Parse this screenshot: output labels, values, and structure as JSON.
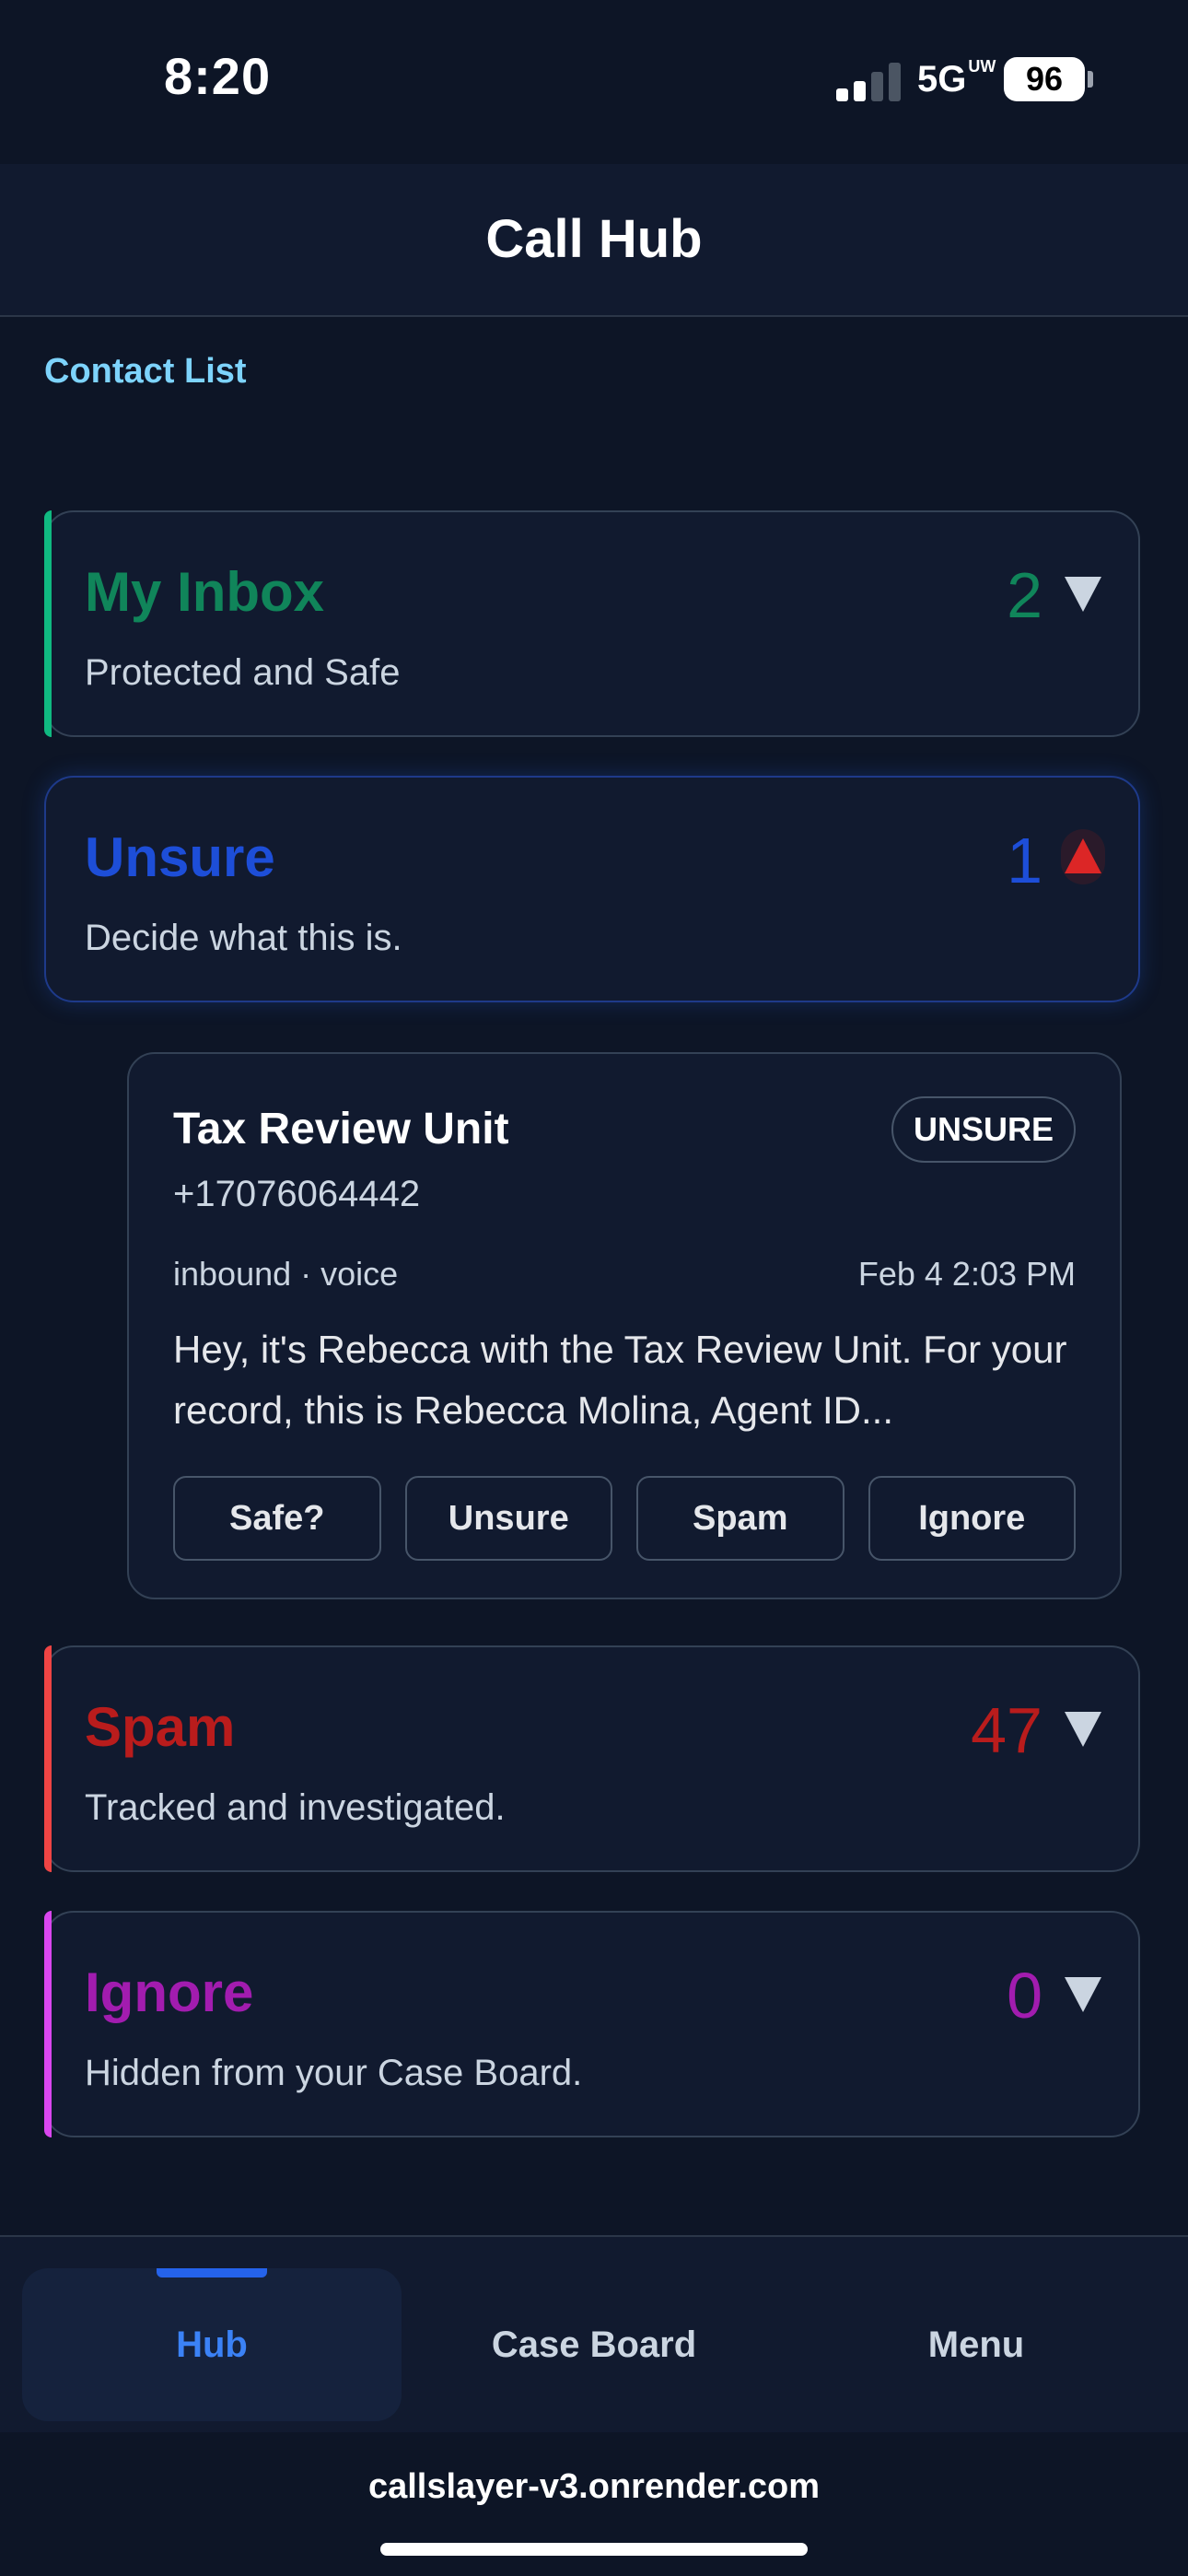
{
  "status_bar": {
    "time": "8:20",
    "network": "5G",
    "network_suffix": "UW",
    "battery": "96"
  },
  "header": {
    "title": "Call Hub"
  },
  "contact_list_label": "Contact List",
  "folders": [
    {
      "title": "My Inbox",
      "subtitle": "Protected and Safe",
      "count": "2",
      "color": "#10855a"
    },
    {
      "title": "Unsure",
      "subtitle": "Decide what this is.",
      "count": "1",
      "color": "#1d4ed8"
    },
    {
      "title": "Spam",
      "subtitle": "Tracked and investigated.",
      "count": "47",
      "color": "#b91c1c"
    },
    {
      "title": "Ignore",
      "subtitle": "Hidden from your Case Board.",
      "count": "0",
      "color": "#a21caf"
    }
  ],
  "call_card": {
    "name": "Tax Review Unit",
    "badge": "UNSURE",
    "phone": "+17076064442",
    "meta": "inbound · voice",
    "date": "Feb 4 2:03 PM",
    "message": "Hey, it's Rebecca with the Tax Review Unit. For your record, this is Rebecca Molina, Agent ID...",
    "actions": [
      "Safe?",
      "Unsure",
      "Spam",
      "Ignore"
    ]
  },
  "bottom_nav": {
    "items": [
      "Hub",
      "Case Board",
      "Menu"
    ],
    "active": "Hub"
  },
  "browser": {
    "url": "callslayer-v3.onrender.com"
  }
}
